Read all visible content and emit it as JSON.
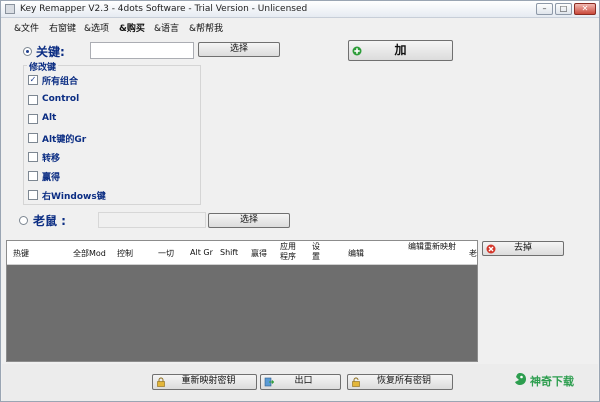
{
  "window": {
    "title": "Key Remapper V2.3 - 4dots Software - Trial Version - Unlicensed",
    "minimize": "–",
    "maximize": "□",
    "close": "✕"
  },
  "menu": [
    "&文件",
    "右窗键",
    "&选项",
    "&购买",
    "&语言",
    "&帮帮我"
  ],
  "key_section": {
    "label": "关键:",
    "input_value": "",
    "select_label": "选择",
    "add_label": "加"
  },
  "modifiers": {
    "title": "修改键",
    "items": [
      {
        "label": "所有组合",
        "checked": true
      },
      {
        "label": "Control",
        "checked": false
      },
      {
        "label": "Alt",
        "checked": false
      },
      {
        "label": "Alt键的Gr",
        "checked": false
      },
      {
        "label": "转移",
        "checked": false
      },
      {
        "label": "赢得",
        "checked": false
      },
      {
        "label": "右Windows键",
        "checked": false
      }
    ]
  },
  "mouse_section": {
    "label": "老鼠 :",
    "select_label": "选择"
  },
  "table": {
    "columns": [
      "热键",
      "全部Mod",
      "控制",
      "一切",
      "Alt Gr",
      "Shift",
      "赢得",
      "应用程序",
      "设置",
      "编辑",
      "编辑重新映射",
      "老"
    ]
  },
  "side": {
    "remove_label": "去掉"
  },
  "footer": {
    "remap_label": "重新映射密钥",
    "exit_label": "出口",
    "restore_label": "恢复所有密钥"
  },
  "watermark": {
    "text": "神奇下载"
  },
  "colors": {
    "label_blue": "#0b2d83",
    "add_icon_green": "#2e9d3a",
    "remove_icon_red": "#d4372b",
    "list_background": "#6e6e6e",
    "watermark_green": "#2d9e4f"
  }
}
